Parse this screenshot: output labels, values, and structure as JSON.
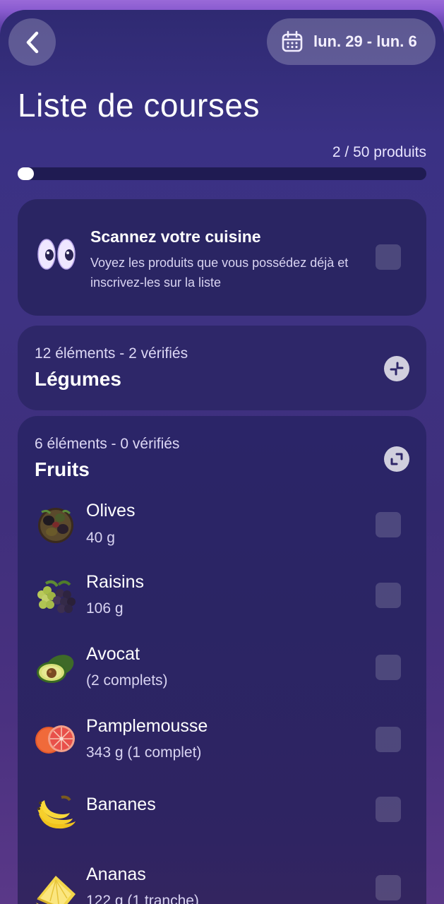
{
  "header": {
    "date_range": "lun. 29 - lun. 6",
    "title": "Liste de courses"
  },
  "progress": {
    "text": "2 / 50 produits",
    "checked": 2,
    "total": 50
  },
  "scan": {
    "title": "Scannez votre cuisine",
    "description": "Voyez les produits que vous possédez déjà et inscrivez-les sur la liste"
  },
  "groups": [
    {
      "subtitle": "12 éléments - 2 vérifiés",
      "title": "Légumes",
      "state": "collapsed"
    },
    {
      "subtitle": "6 éléments - 0 vérifiés",
      "title": "Fruits",
      "state": "expanded"
    }
  ],
  "fruits": [
    {
      "name": "Olives",
      "qty": "40 g",
      "icon": "olives-icon"
    },
    {
      "name": "Raisins",
      "qty": "106 g",
      "icon": "grapes-icon"
    },
    {
      "name": "Avocat",
      "qty": "(2 complets)",
      "icon": "avocado-icon"
    },
    {
      "name": "Pamplemousse",
      "qty": "343 g  (1 complet)",
      "icon": "grapefruit-icon"
    },
    {
      "name": "Bananes",
      "qty": "",
      "icon": "banana-icon"
    },
    {
      "name": "Ananas",
      "qty": "122 g  (1 tranche)",
      "icon": "pineapple-icon"
    }
  ],
  "colors": {
    "accent": "#3a3184",
    "card": "#2a2466",
    "text": "#ffffff",
    "checkbox": "#5a5484"
  }
}
